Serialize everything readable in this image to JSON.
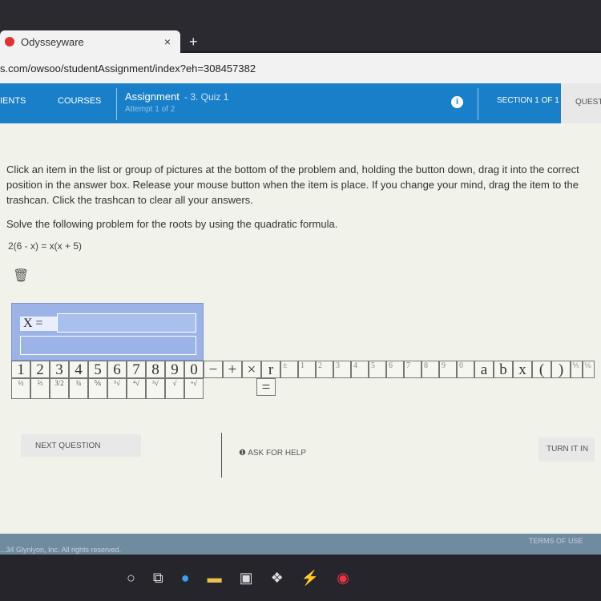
{
  "browser": {
    "tab_title": "Odysseyware",
    "close": "×",
    "new_tab": "+",
    "url": "s.com/owsoo/studentAssignment/index?eh=308457382"
  },
  "nav": {
    "items": [
      "IENTS",
      "COURSES"
    ],
    "assignment": "Assignment",
    "quiz": "- 3. Quiz 1",
    "attempt": "Attempt 1 of 2",
    "info": "i",
    "section": "SECTION 1 OF 1",
    "question": "QUESTI"
  },
  "content": {
    "instructions": "Click an item in the list or group of pictures at the bottom of the problem and, holding the button down, drag it into the correct position in the answer box. Release your mouse button when the item is place. If you change your mind, drag the item to the trashcan. Click the trashcan to clear all your answers.",
    "question": "Solve the following problem for the roots by using the quadratic formula.",
    "equation": "2(6 - x) = x(x + 5)",
    "answer_var": "X =",
    "tiles_row1": [
      "1",
      "2",
      "3",
      "4",
      "5",
      "6",
      "7",
      "8",
      "9",
      "0",
      "−",
      "+",
      "×",
      "r",
      "±",
      "1",
      "2",
      "3",
      "4",
      "5",
      "6",
      "7",
      "8",
      "9",
      "0",
      "a",
      "b",
      "x",
      "(",
      ")",
      "⅗",
      "⅙"
    ],
    "tiles_row2": [
      "½",
      "⅔",
      "3/2",
      "¾",
      "⅚",
      "⁵√",
      "⁴√",
      "³√",
      "√",
      "ⁿ√"
    ],
    "equals": "="
  },
  "buttons": {
    "next": "NEXT QUESTION",
    "help": "ASK FOR HELP",
    "turn_in": "TURN IT IN"
  },
  "footer": {
    "copyright": "...34 Glynlyon, Inc. All rights reserved.",
    "terms": "TERMS OF USE"
  }
}
